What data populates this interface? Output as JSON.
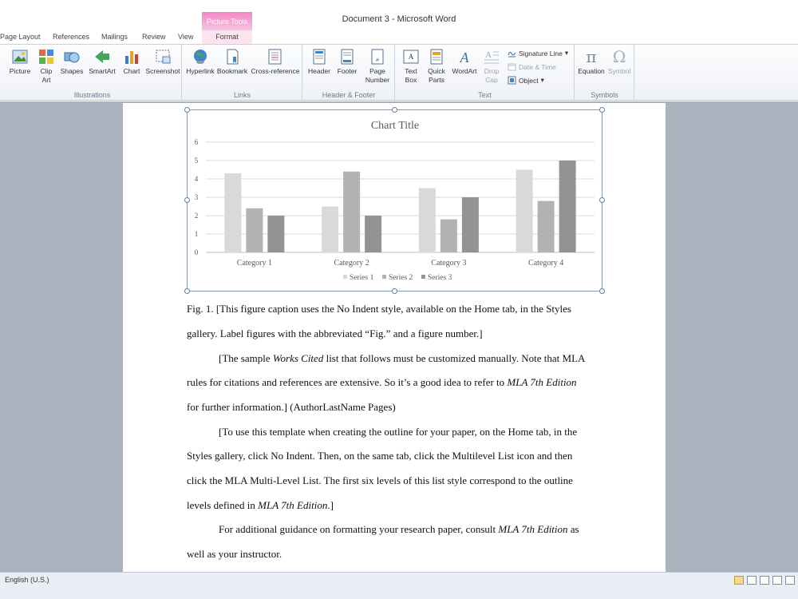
{
  "window": {
    "title": "Document 3  -  Microsoft Word",
    "contextual_group": "Picture Tools"
  },
  "tabs": [
    "Page Layout",
    "References",
    "Mailings",
    "Review",
    "View"
  ],
  "active_tab": "Format",
  "ribbon": {
    "illustrations": {
      "label": "Illustrations",
      "buttons": [
        {
          "label": "Picture",
          "icon": "picture-icon"
        },
        {
          "label": "Clip\nArt",
          "icon": "clip-art-icon"
        },
        {
          "label": "Shapes",
          "icon": "shapes-icon"
        },
        {
          "label": "SmartArt",
          "icon": "smartart-icon"
        },
        {
          "label": "Chart",
          "icon": "chart-icon"
        },
        {
          "label": "Screenshot",
          "icon": "screenshot-icon"
        }
      ]
    },
    "links": {
      "label": "Links",
      "buttons": [
        {
          "label": "Hyperlink",
          "icon": "hyperlink-icon"
        },
        {
          "label": "Bookmark",
          "icon": "bookmark-icon"
        },
        {
          "label": "Cross-reference",
          "icon": "cross-reference-icon"
        }
      ]
    },
    "header_footer": {
      "label": "Header & Footer",
      "buttons": [
        {
          "label": "Header",
          "icon": "header-icon"
        },
        {
          "label": "Footer",
          "icon": "footer-icon"
        },
        {
          "label": "Page\nNumber",
          "icon": "page-number-icon"
        }
      ]
    },
    "text": {
      "label": "Text",
      "buttons": [
        {
          "label": "Text\nBox",
          "icon": "text-box-icon"
        },
        {
          "label": "Quick\nParts",
          "icon": "quick-parts-icon"
        },
        {
          "label": "WordArt",
          "icon": "wordart-icon"
        },
        {
          "label": "Drop\nCap",
          "icon": "drop-cap-icon"
        }
      ],
      "small": [
        {
          "label": "Signature Line",
          "icon": "signature-line-icon"
        },
        {
          "label": "Date & Time",
          "icon": "date-time-icon"
        },
        {
          "label": "Object",
          "icon": "object-icon"
        }
      ]
    },
    "symbols": {
      "label": "Symbols",
      "buttons": [
        {
          "label": "Equation",
          "icon": "equation-icon",
          "glyph": "π"
        },
        {
          "label": "Symbol",
          "icon": "symbol-icon",
          "glyph": "Ω"
        }
      ]
    }
  },
  "chart_data": {
    "type": "bar",
    "title": "Chart Title",
    "categories": [
      "Category 1",
      "Category 2",
      "Category 3",
      "Category 4"
    ],
    "series": [
      {
        "name": "Series 1",
        "values": [
          4.3,
          2.5,
          3.5,
          4.5
        ],
        "color": "#d9d9d9"
      },
      {
        "name": "Series 2",
        "values": [
          2.4,
          4.4,
          1.8,
          2.8
        ],
        "color": "#b2b2b2"
      },
      {
        "name": "Series 3",
        "values": [
          2,
          2,
          3,
          5
        ],
        "color": "#939393"
      }
    ],
    "ylim": [
      0,
      6
    ],
    "yticks": [
      "0",
      "1",
      "2",
      "3",
      "4",
      "5",
      "6"
    ],
    "grid": true,
    "legend": "bottom"
  },
  "body": {
    "caption_l1": "Fig. 1. [This figure caption uses the No Indent style, available on the Home tab, in the Styles",
    "caption_l2": "gallery. Label figures with the abbreviated “Fig.” and a figure number.]",
    "p1_l1_a": "[The sample ",
    "p1_l1_i": "Works Cited",
    "p1_l1_b": " list that follows must be customized manually. Note that MLA",
    "p1_l2_a": "rules for citations and references are extensive. So it’s a good idea to refer to ",
    "p1_l2_i": "MLA 7th Edition",
    "p1_l3": "for further information.] (AuthorLastName Pages)",
    "p2_l1": "[To use this template when creating the outline for your paper, on the Home tab, in the",
    "p2_l2": "Styles gallery, click No Indent. Then, on the same tab, click the Multilevel List icon and then",
    "p2_l3": "click the MLA Multi-Level List. The first six levels of this list style correspond to the outline",
    "p2_l4_a": "levels defined in ",
    "p2_l4_i": "MLA 7th Edition",
    "p2_l4_b": ".]",
    "p3_l1_a": "For additional guidance on formatting your research paper, consult ",
    "p3_l1_i": "MLA 7th Edition",
    "p3_l1_b": " as",
    "p3_l2": "well as your instructor."
  },
  "status": {
    "language": "English (U.S.)"
  }
}
